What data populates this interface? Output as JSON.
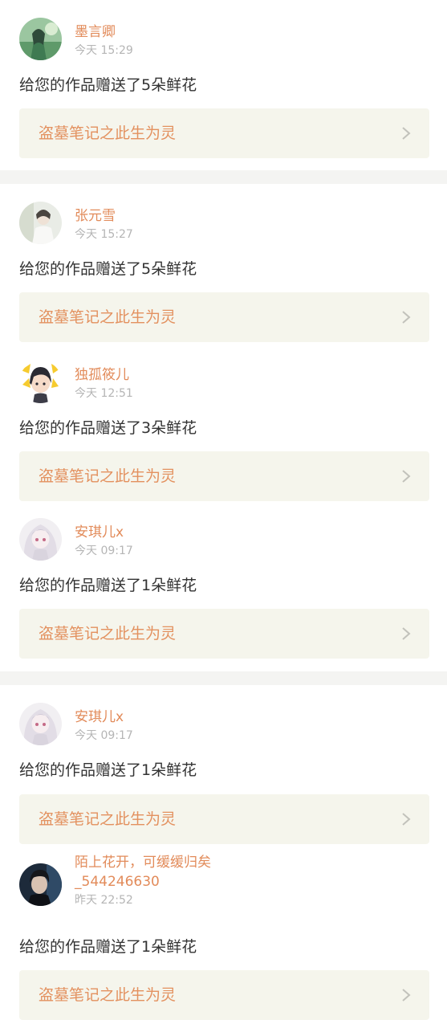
{
  "groups": [
    {
      "items": [
        {
          "username": "墨言卿",
          "time": "今天 15:29",
          "message": "给您的作品赠送了5朵鲜花",
          "work_title": "盗墓笔记之此生为灵",
          "avatar": "landscape-girl"
        }
      ]
    },
    {
      "items": [
        {
          "username": "张元雪",
          "time": "今天 15:27",
          "message": "给您的作品赠送了5朵鲜花",
          "work_title": "盗墓笔记之此生为灵",
          "avatar": "light-person"
        },
        {
          "username": "独孤筱儿",
          "time": "今天 12:51",
          "message": "给您的作品赠送了3朵鲜花",
          "work_title": "盗墓笔记之此生为灵",
          "avatar": "cartoon-girl"
        },
        {
          "username": "安琪儿x",
          "time": "今天 09:17",
          "message": "给您的作品赠送了1朵鲜花",
          "work_title": "盗墓笔记之此生为灵",
          "avatar": "anime-girl"
        }
      ]
    },
    {
      "items": [
        {
          "username": "安琪儿x",
          "time": "今天 09:17",
          "message": "给您的作品赠送了1朵鲜花",
          "work_title": "盗墓笔记之此生为灵",
          "avatar": "anime-girl"
        },
        {
          "username_line1": "陌上花开，可缓缓归矣",
          "username_line2": "_544246630",
          "time": "昨天 22:52",
          "message": "给您的作品赠送了1朵鲜花",
          "work_title": "盗墓笔记之此生为灵",
          "avatar": "dark-boy"
        }
      ]
    }
  ],
  "icons": {
    "chevron": "chevron-right-icon"
  },
  "colors": {
    "accent": "#e28b5a",
    "card_bg": "#f5f5ec",
    "time": "#b5b5b5",
    "text": "#333333"
  }
}
